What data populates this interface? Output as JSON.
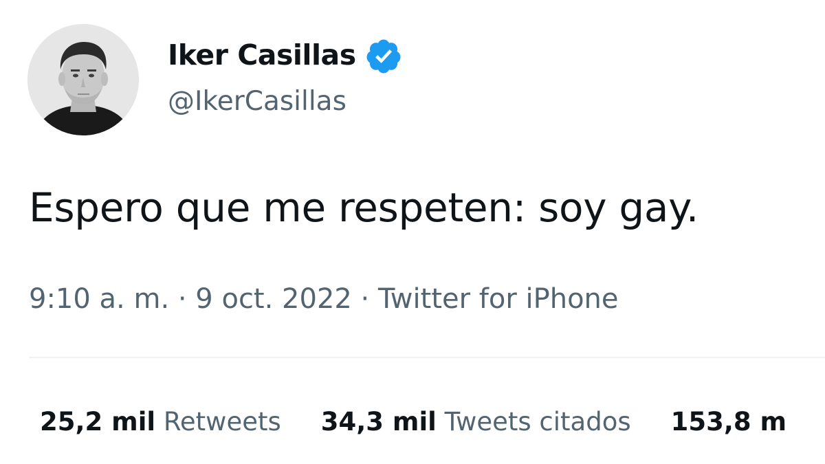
{
  "tweet": {
    "author": {
      "display_name": "Iker Casillas",
      "handle": "@IkerCasillas",
      "verified": true,
      "avatar": "profile-photo"
    },
    "text": "Espero que me respeten: soy gay.",
    "meta": "9:10 a. m. · 9 oct. 2022 · Twitter for iPhone",
    "stats": [
      {
        "count": "25,2 mil",
        "label": "Retweets"
      },
      {
        "count": "34,3 mil",
        "label": "Tweets citados"
      },
      {
        "count": "153,8 m",
        "label": ""
      }
    ]
  },
  "colors": {
    "text": "#0f1419",
    "secondary": "#536471",
    "verified_badge": "#1d9bf0",
    "divider": "#eff3f4"
  },
  "icons": {
    "verified": "verified-badge-icon"
  }
}
